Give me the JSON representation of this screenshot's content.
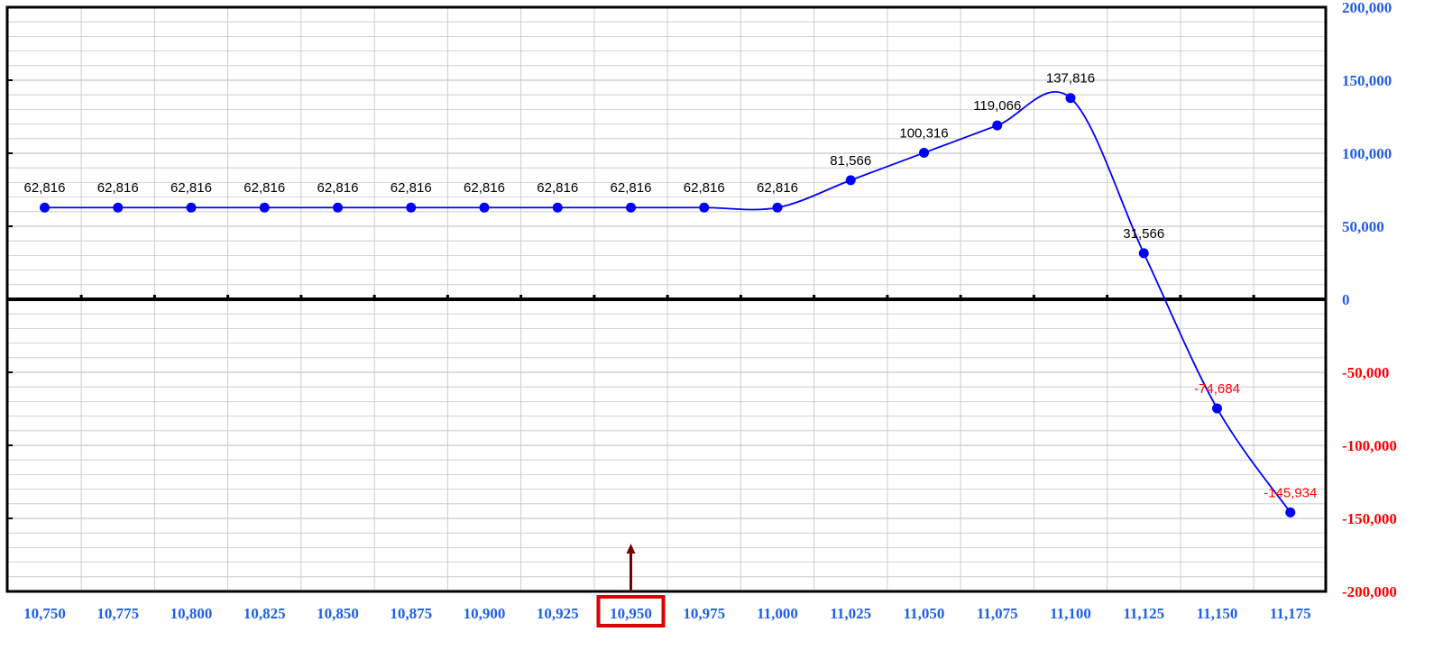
{
  "chart_data": {
    "type": "line",
    "title": "",
    "xlabel": "",
    "ylabel": "",
    "x": [
      "10,750",
      "10,775",
      "10,800",
      "10,825",
      "10,850",
      "10,875",
      "10,900",
      "10,925",
      "10,950",
      "10,975",
      "11,000",
      "11,025",
      "11,050",
      "11,075",
      "11,100",
      "11,125",
      "11,150",
      "11,175"
    ],
    "series": [
      {
        "values": [
          62816,
          62816,
          62816,
          62816,
          62816,
          62816,
          62816,
          62816,
          62816,
          62816,
          62816,
          81566,
          100316,
          119066,
          137816,
          31566,
          -74684,
          -145934
        ],
        "labels": [
          "62,816",
          "62,816",
          "62,816",
          "62,816",
          "62,816",
          "62,816",
          "62,816",
          "62,816",
          "62,816",
          "62,816",
          "62,816",
          "81,566",
          "100,316",
          "119,066",
          "137,816",
          "31,566",
          "-74,684",
          "-145,934"
        ]
      }
    ],
    "yticks": [
      200000,
      150000,
      100000,
      50000,
      0,
      -50000,
      -100000,
      -150000,
      -200000
    ],
    "ytick_labels": [
      "200,000",
      "150,000",
      "100,000",
      "50,000",
      "0",
      "-50,000",
      "-100,000",
      "-150,000",
      "-200,000"
    ],
    "ylim": [
      -200000,
      200000
    ],
    "y_axis_position": "right",
    "grid": true,
    "highlighted_x": "10,950",
    "marker_arrow_at": "10,950",
    "colors": {
      "line": "#0000ff",
      "positive_tick": "#1f5fe8",
      "negative_tick": "#ff0000",
      "positive_label": "#000000",
      "negative_label": "#ff0000",
      "highlight_box": "#e00000",
      "arrow": "#7a0000",
      "grid": "#c8c8c8"
    }
  }
}
